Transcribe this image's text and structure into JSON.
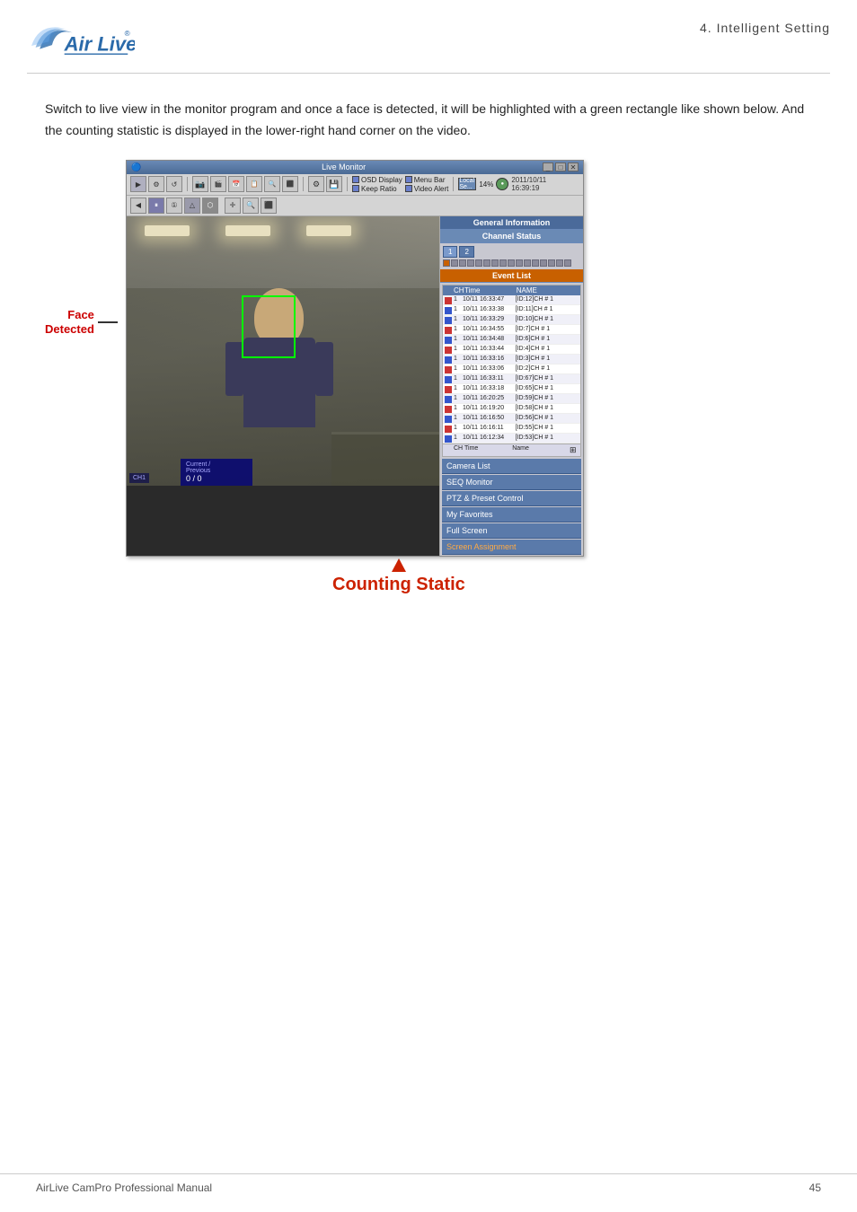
{
  "header": {
    "chapter": "4.  Intelligent  Setting",
    "logo_alt": "Air Live"
  },
  "body_text": "Switch to live view in the monitor program and once a face is detected, it will be highlighted with a green rectangle like shown below. And the counting statistic is displayed in the lower-right hand corner on the video.",
  "live_monitor": {
    "title": "Live Monitor",
    "toolbar": {
      "osd_display": "OSD Display",
      "keep_ratio": "Keep Ratio",
      "menu_bar": "Menu Bar",
      "video_alert": "Video Alert",
      "local_se_label": "Local Se...",
      "local_se_percent": "14%",
      "datetime": "2011/10/11",
      "time": "16:39:19"
    },
    "general_info": "General Information",
    "channel_status": "Channel Status",
    "event_list_header": "Event List",
    "event_columns": [
      "CH",
      "Time",
      "NAME"
    ],
    "events": [
      {
        "ch": "1",
        "time": "10/11 16:33:47",
        "name": "[ID:12]CH # 1"
      },
      {
        "ch": "1",
        "time": "10/11 16:33:38",
        "name": "[ID:11]CH # 1"
      },
      {
        "ch": "1",
        "time": "10/11 16:33:29",
        "name": "[ID:10]CH # 1"
      },
      {
        "ch": "1",
        "time": "10/11 16:34:55",
        "name": "[ID:7]CH # 1"
      },
      {
        "ch": "1",
        "time": "10/11 16:34:48",
        "name": "[ID:6]CH # 1"
      },
      {
        "ch": "1",
        "time": "10/11 16:33:44",
        "name": "[ID:4]CH # 1"
      },
      {
        "ch": "1",
        "time": "10/11 16:33:16",
        "name": "[ID:3]CH # 1"
      },
      {
        "ch": "1",
        "time": "10/11 16:33:06",
        "name": "[ID:2]CH # 1"
      },
      {
        "ch": "1",
        "time": "10/11 16:33:11",
        "name": "[ID:67]CH # 1"
      },
      {
        "ch": "1",
        "time": "10/11 16:33:18",
        "name": "[ID:65]CH # 1"
      },
      {
        "ch": "1",
        "time": "10/11 16:20:25",
        "name": "[ID:59]CH # 1"
      },
      {
        "ch": "1",
        "time": "10/11 16:19:20",
        "name": "[ID:58]CH # 1"
      },
      {
        "ch": "1",
        "time": "10/11 16:16:50",
        "name": "[ID:56]CH # 1"
      },
      {
        "ch": "1",
        "time": "10/11 16:16:11",
        "name": "[ID:55]CH # 1"
      },
      {
        "ch": "1",
        "time": "10/11 16:12:34",
        "name": "[ID:53]CH # 1"
      }
    ],
    "event_footer_cols": [
      "CH",
      "Time",
      "Name"
    ],
    "camera_list": "Camera List",
    "seq_monitor": "SEQ Monitor",
    "ptz_preset": "PTZ & Preset Control",
    "my_favorites": "My Favorites",
    "full_screen": "Full Screen",
    "screen_assignment": "Screen Assignment",
    "counter_label": "Current /\nPrevious",
    "counter_values": "0 / 0"
  },
  "face_detected_label": "Face\nDetected",
  "counting_static_label": "Counting Static",
  "footer": {
    "left": "AirLive  CamPro  Professional  Manual",
    "right": "45"
  }
}
